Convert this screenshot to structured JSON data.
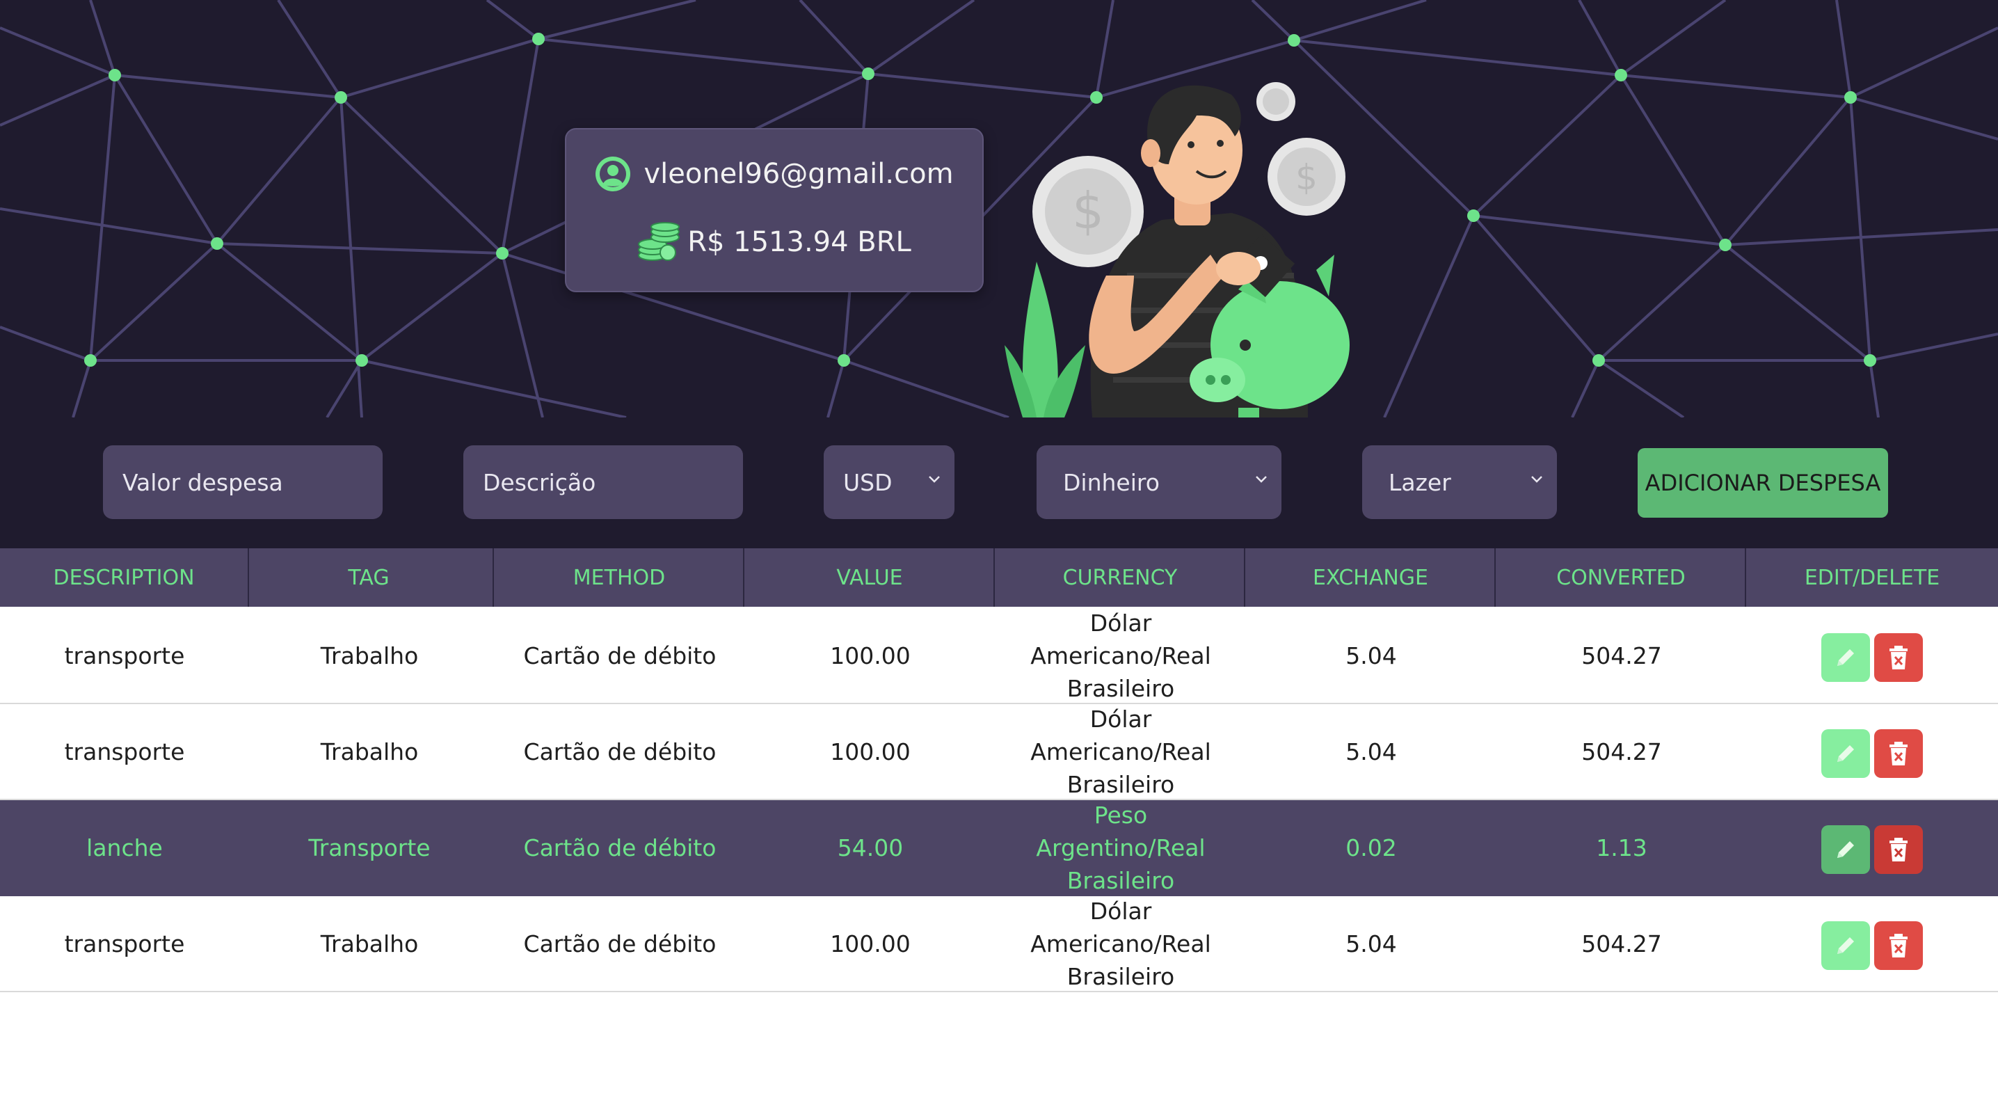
{
  "user": {
    "email": "vleonel96@gmail.com",
    "total": "R$ 1513.94 BRL"
  },
  "form": {
    "value_placeholder": "Valor despesa",
    "description_placeholder": "Descrição",
    "currency": "USD",
    "method": "Dinheiro",
    "tag": "Lazer",
    "add_label": "ADICIONAR DESPESA"
  },
  "table": {
    "headers": [
      "DESCRIPTION",
      "TAG",
      "METHOD",
      "VALUE",
      "CURRENCY",
      "EXCHANGE",
      "CONVERTED",
      "EDIT/DELETE"
    ],
    "rows": [
      {
        "description": "transporte",
        "tag": "Trabalho",
        "method": "Cartão de débito",
        "value": "100.00",
        "currency": "Dólar Americano/Real Brasileiro",
        "exchange": "5.04",
        "converted": "504.27"
      },
      {
        "description": "transporte",
        "tag": "Trabalho",
        "method": "Cartão de débito",
        "value": "100.00",
        "currency": "Dólar Americano/Real Brasileiro",
        "exchange": "5.04",
        "converted": "504.27"
      },
      {
        "description": "lanche",
        "tag": "Transporte",
        "method": "Cartão de débito",
        "value": "54.00",
        "currency": "Peso Argentino/Real Brasileiro",
        "exchange": "0.02",
        "converted": "1.13"
      },
      {
        "description": "transporte",
        "tag": "Trabalho",
        "method": "Cartão de débito",
        "value": "100.00",
        "currency": "Dólar Americano/Real Brasileiro",
        "exchange": "5.04",
        "converted": "504.27"
      }
    ]
  },
  "icons": {
    "user": "user-icon",
    "coins": "coins-icon",
    "edit": "pencil-icon",
    "delete": "trash-icon",
    "illustration": "man-with-piggy-bank-illustration"
  },
  "colors": {
    "accent": "#6de38a",
    "background": "#1f1b2e",
    "panel": "#4d4565",
    "danger": "#e04b45"
  }
}
